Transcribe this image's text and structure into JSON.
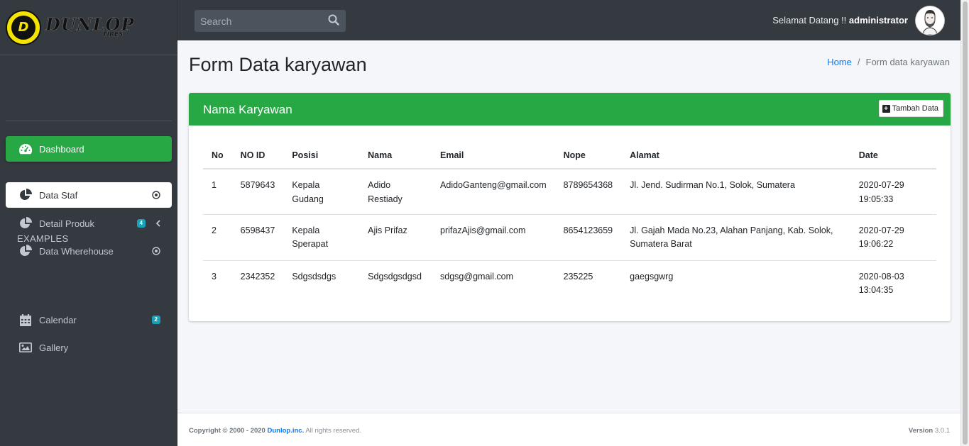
{
  "brand": {
    "name": "DUNLOP",
    "sub": "TIRES",
    "logo_letter": "D"
  },
  "sidebar": {
    "items": [
      {
        "label": "Dashboard",
        "icon": "tachometer-icon"
      },
      {
        "label": "Data Staf",
        "icon": "chart-pie-icon"
      },
      {
        "label": "Detail Produk",
        "icon": "chart-pie-icon",
        "badge": "4"
      },
      {
        "label": "Data Wherehouse",
        "icon": "chart-pie-icon"
      }
    ],
    "section_header": "EXAMPLES",
    "examples": [
      {
        "label": "Calendar",
        "icon": "calendar-icon",
        "badge": "2"
      },
      {
        "label": "Gallery",
        "icon": "image-icon"
      }
    ]
  },
  "topbar": {
    "search_placeholder": "Search",
    "welcome_text": "Selamat Datang !!",
    "username": "administrator"
  },
  "page": {
    "title": "Form Data karyawan",
    "breadcrumb_home": "Home",
    "breadcrumb_current": "Form data karyawan"
  },
  "card": {
    "title": "Nama Karyawan",
    "add_button": "Tambah Data"
  },
  "table": {
    "headers": [
      "No",
      "NO ID",
      "Posisi",
      "Nama",
      "Email",
      "Nope",
      "Alamat",
      "Date"
    ],
    "rows": [
      [
        "1",
        "5879643",
        "Kepala Gudang",
        "Adido Restiady",
        "AdidoGanteng@gmail.com",
        "8789654368",
        "Jl. Jend. Sudirman No.1, Solok, Sumatera",
        "2020-07-29 19:05:33"
      ],
      [
        "2",
        "6598437",
        "Kepala Sperapat",
        "Ajis Prifaz",
        "prifazAjis@gmail.com",
        "8654123659",
        "Jl. Gajah Mada No.23, Alahan Panjang, Kab. Solok, Sumatera Barat",
        "2020-07-29 19:06:22"
      ],
      [
        "3",
        "2342352",
        "Sdgsdsdgs",
        "Sdgsdgsdgsd",
        "sdgsg@gmail.com",
        "235225",
        "gaegsgwrg",
        "2020-08-03 13:04:35"
      ]
    ]
  },
  "footer": {
    "copyright": "Copyright © 2000 - 2020",
    "company": "Dunlop.inc.",
    "rights": "All rights reserved.",
    "version_label": "Version",
    "version": "3.0.1"
  },
  "colors": {
    "accent": "#28a745",
    "sidebar": "#343a40",
    "link": "#007bff",
    "badge": "#17a2b8"
  }
}
